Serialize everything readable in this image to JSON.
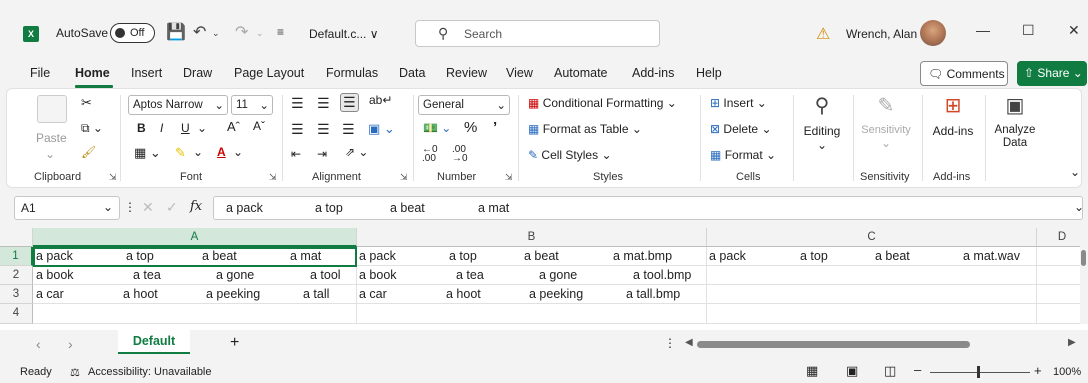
{
  "title_bar": {
    "autosave_label": "AutoSave",
    "autosave_state": "Off",
    "filename": "Default.c... ∨",
    "search_placeholder": "Search",
    "user_name": "Wrench, Alan"
  },
  "menu": {
    "items": [
      "File",
      "Home",
      "Insert",
      "Draw",
      "Page Layout",
      "Formulas",
      "Data",
      "Review",
      "View",
      "Automate",
      "Add-ins",
      "Help"
    ],
    "active": "Home",
    "comments_label": "Comments",
    "share_label": "Share"
  },
  "ribbon": {
    "clipboard": {
      "paste_label": "Paste",
      "group_label": "Clipboard"
    },
    "font": {
      "font_name": "Aptos Narrow",
      "font_size": "11",
      "group_label": "Font"
    },
    "alignment": {
      "group_label": "Alignment"
    },
    "number": {
      "format": "General",
      "group_label": "Number"
    },
    "styles": {
      "conditional_formatting": "Conditional Formatting",
      "format_as_table": "Format as Table",
      "cell_styles": "Cell Styles",
      "group_label": "Styles"
    },
    "cells": {
      "insert": "Insert",
      "delete": "Delete",
      "format": "Format",
      "group_label": "Cells"
    },
    "editing": {
      "label": "Editing"
    },
    "sensitivity": {
      "button_label": "Sensitivity",
      "group_label": "Sensitivity"
    },
    "addins": {
      "button_label": "Add-ins",
      "group_label": "Add-ins"
    },
    "analyze": {
      "line1": "Analyze",
      "line2": "Data"
    }
  },
  "formula_bar": {
    "name_box": "A1",
    "fx_label": "fx",
    "content": [
      "a pack",
      "a top",
      "a beat",
      "a mat"
    ]
  },
  "grid": {
    "columns": [
      "A",
      "B",
      "C",
      "D"
    ],
    "rows": [
      "1",
      "2",
      "3",
      "4"
    ],
    "cells": {
      "a1": [
        "a pack",
        "a top",
        "a beat",
        "a mat"
      ],
      "a2": [
        "a book",
        "a tea",
        "a gone",
        "a tool"
      ],
      "a3": [
        "a car",
        "a hoot",
        "a peeking",
        "a tall"
      ],
      "b1": [
        "a pack",
        "a top",
        "a beat",
        "a mat.bmp"
      ],
      "b2": [
        "a book",
        "a tea",
        "a gone",
        "a tool.bmp"
      ],
      "b3": [
        "a car",
        "a hoot",
        "a peeking",
        "a tall.bmp"
      ],
      "c1": [
        "a pack",
        "a top",
        "a beat",
        "a mat.wav"
      ]
    }
  },
  "sheets": {
    "active": "Default",
    "add_label": "+"
  },
  "status": {
    "ready": "Ready",
    "accessibility": "Accessibility: Unavailable",
    "zoom": "100%"
  }
}
